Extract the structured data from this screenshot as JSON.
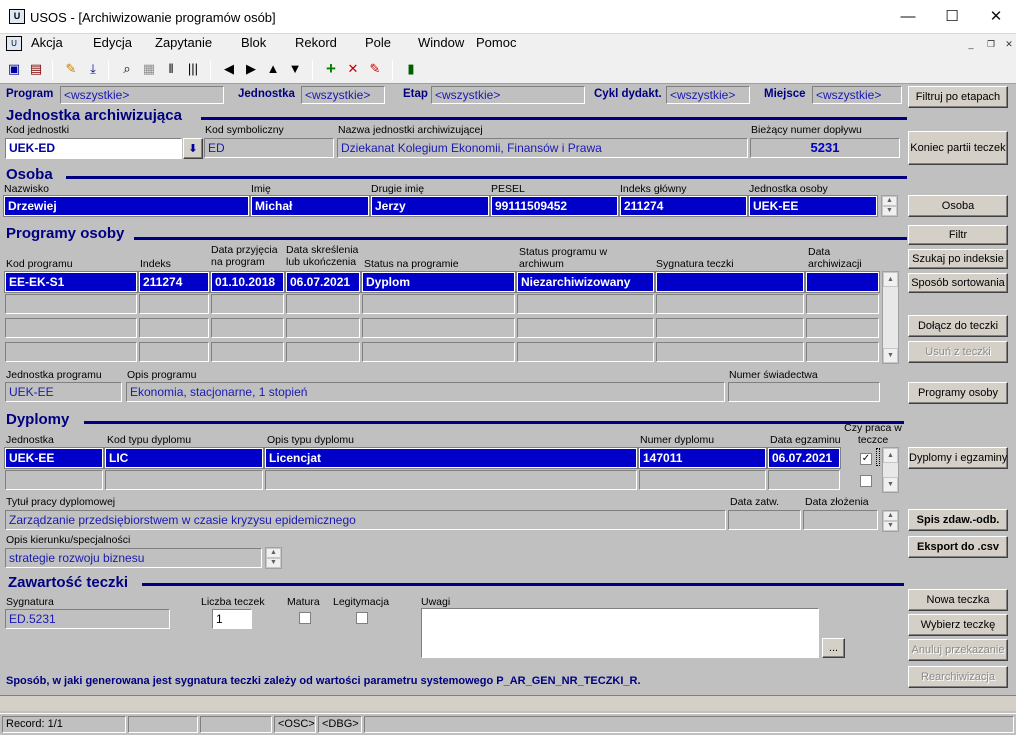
{
  "window": {
    "title": "USOS - [Archiwizowanie programów osób]",
    "minimize": "—",
    "maximize": "☐",
    "close": "✕"
  },
  "menu": [
    "Akcja",
    "Edycja",
    "Zapytanie",
    "Blok",
    "Rekord",
    "Pole",
    "Window",
    "Pomoc"
  ],
  "filters": {
    "program_label": "Program",
    "program_value": "<wszystkie>",
    "jednostka_label": "Jednostka",
    "jednostka_value": "<wszystkie>",
    "etap_label": "Etap",
    "etap_value": "<wszystkie>",
    "cykl_label": "Cykl dydakt.",
    "cykl_value": "<wszystkie>",
    "miejsce_label": "Miejsce",
    "miejsce_value": "<wszystkie>",
    "filter_button": "Filtruj po etapach"
  },
  "jednostka_arch": {
    "section": "Jednostka archiwizująca",
    "kod_label": "Kod jednostki",
    "kod_value": "UEK-ED",
    "symbol_label": "Kod symboliczny",
    "symbol_value": "ED",
    "nazwa_label": "Nazwa jednostki archiwizującej",
    "nazwa_value": "Dziekanat Kolegium Ekonomii, Finansów i Prawa",
    "numer_label": "Bieżący numer dopływu",
    "numer_value": "5231",
    "button": "Koniec partii teczek"
  },
  "osoba": {
    "section": "Osoba",
    "headers": [
      "Nazwisko",
      "Imię",
      "Drugie imię",
      "PESEL",
      "Indeks główny",
      "Jednostka osoby"
    ],
    "values": [
      "Drzewiej",
      "Michał",
      "Jerzy",
      "99111509452",
      "211274",
      "UEK-EE"
    ],
    "button": "Osoba"
  },
  "programy": {
    "section": "Programy osoby",
    "headers": [
      "Kod programu",
      "Indeks",
      "Data przyjęcia na program",
      "Data skreślenia lub ukończenia",
      "Status na programie",
      "Status programu w archiwum",
      "Sygnatura teczki",
      "Data archiwizacji"
    ],
    "row": [
      "EE-EK-S1",
      "211274",
      "01.10.2018",
      "06.07.2021",
      "Dyplom",
      "Niezarchiwizowany",
      "",
      ""
    ],
    "jednostka_label": "Jednostka  programu",
    "jednostka_value": "UEK-EE",
    "opis_label": "Opis programu",
    "opis_value": "Ekonomia, stacjonarne, 1 stopień",
    "swiadectwo_label": "Numer świadectwa",
    "swiadectwo_value": ""
  },
  "side_buttons": {
    "filtr": "Filtr",
    "szukaj": "Szukaj po indeksie",
    "sortowanie": "Sposób sortowania",
    "dolacz": "Dołącz do teczki",
    "usun": "Usuń z teczki",
    "programy_osoby": "Programy osoby",
    "dyplomy": "Dyplomy i egzaminy",
    "spis": "Spis zdaw.-odb.",
    "eksport": "Eksport do .csv",
    "nowa": "Nowa teczka",
    "wybierz": "Wybierz teczkę",
    "anuluj": "Anuluj przekazanie",
    "rearch": "Rearchiwizacja"
  },
  "dyplomy": {
    "section": "Dyplomy",
    "headers": [
      "Jednostka",
      "Kod typu dyplomu",
      "Opis typu dyplomu",
      "Numer dyplomu",
      "Data egzaminu",
      "Czy praca w teczce"
    ],
    "row": [
      "UEK-EE",
      "LIC",
      "Licencjat",
      "147011",
      "06.07.2021"
    ],
    "checked": "✓",
    "tytul_label": "Tytuł pracy dyplomowej",
    "tytul_value": "Zarządzanie przedsiębiorstwem w czasie kryzysu epidemicznego",
    "zatw_label": "Data zatw.",
    "zlozenia_label": "Data złożenia",
    "kierunek_label": "Opis kierunku/specjalności",
    "kierunek_value": "strategie rozwoju biznesu"
  },
  "teczka": {
    "section": "Zawartość teczki",
    "sygnatura_label": "Sygnatura",
    "sygnatura_value": "ED.5231",
    "liczba_label": "Liczba teczek",
    "liczba_value": "1",
    "matura_label": "Matura",
    "legitymacja_label": "Legitymacja",
    "uwagi_label": "Uwagi",
    "more": "..."
  },
  "hint": "Sposób, w jaki generowana jest sygnatura teczki zależy od wartości parametru systemowego  P_AR_GEN_NR_TECZKI_R.",
  "status": {
    "record": "Record: 1/1",
    "osc": "<OSC>",
    "dbg": "<DBG>"
  }
}
